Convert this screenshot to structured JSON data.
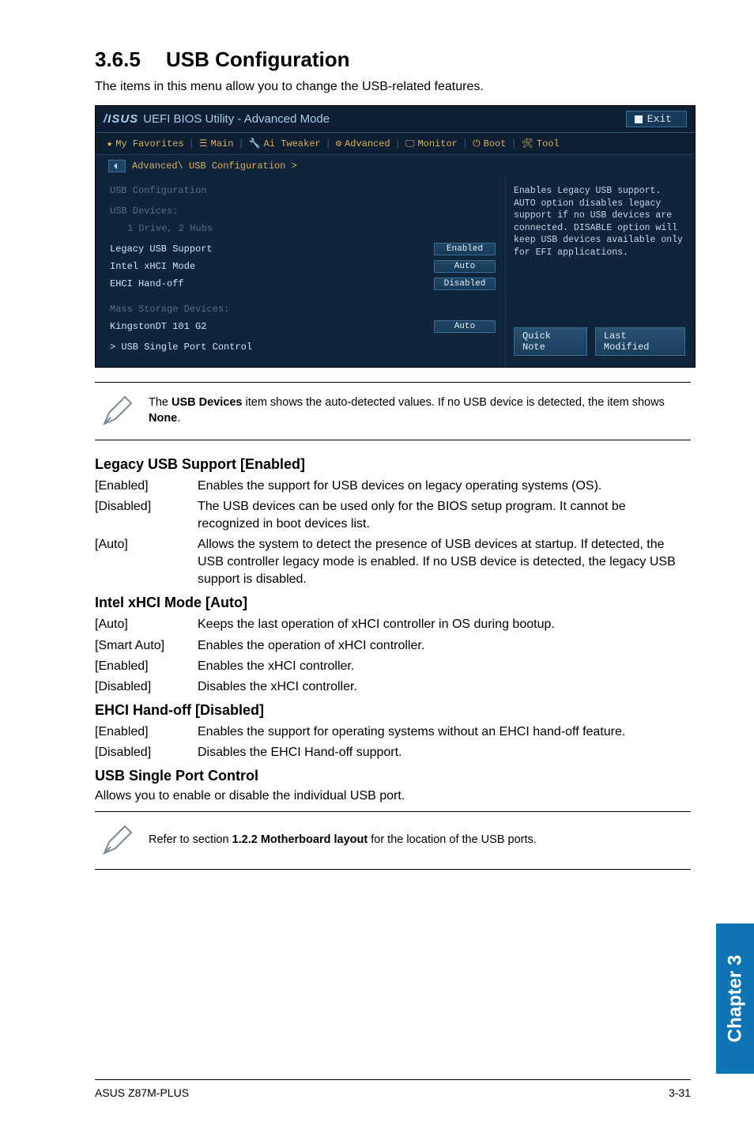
{
  "section": {
    "number": "3.6.5",
    "title": "USB Configuration"
  },
  "intro": "The items in this menu allow you to change the USB-related features.",
  "bios": {
    "brand_logo": "/ISUS",
    "title": "UEFI BIOS Utility - Advanced Mode",
    "exit_label": "Exit",
    "tabs": {
      "favorites": "My Favorites",
      "main": "Main",
      "ai_tweaker": "Ai Tweaker",
      "advanced": "Advanced",
      "monitor": "Monitor",
      "boot": "Boot",
      "tool": "Tool"
    },
    "breadcrumb": "Advanced\\ USB Configuration >",
    "left": {
      "heading": "USB Configuration",
      "devices_label": "USB Devices:",
      "devices_value": "1 Drive, 2 Hubs",
      "items": [
        {
          "label": "Legacy USB Support",
          "value": "Enabled"
        },
        {
          "label": "Intel xHCI Mode",
          "value": "Auto"
        },
        {
          "label": "EHCI Hand-off",
          "value": "Disabled"
        }
      ],
      "mass_heading": "Mass Storage Devices:",
      "mass_item": {
        "label": "KingstonDT 101 G2",
        "value": "Auto"
      },
      "single_port": "> USB Single Port Control"
    },
    "help": "Enables Legacy USB support. AUTO option disables legacy support if no USB devices are connected. DISABLE option will keep USB devices available only for EFI applications.",
    "quick_note": "Quick Note",
    "last_modified": "Last Modified"
  },
  "note1": {
    "prefix": "The ",
    "bold": "USB Devices",
    "mid": " item shows the auto-detected values. If no USB device is detected, the item shows ",
    "bold2": "None",
    "suffix": "."
  },
  "legacy": {
    "heading": "Legacy USB Support [Enabled]",
    "rows": [
      {
        "key": "[Enabled]",
        "val": "Enables the support for USB devices on legacy operating systems (OS)."
      },
      {
        "key": "[Disabled]",
        "val": "The USB devices can be used only for the BIOS setup program. It cannot be recognized in boot devices list."
      },
      {
        "key": "[Auto]",
        "val": "Allows the system to detect the presence of USB devices at startup. If detected, the USB controller legacy mode is enabled. If no USB device is detected, the legacy USB support is disabled."
      }
    ]
  },
  "xhci": {
    "heading": "Intel xHCI Mode [Auto]",
    "rows": [
      {
        "key": "[Auto]",
        "val": "Keeps the last operation of xHCI controller in OS during bootup."
      },
      {
        "key": "[Smart Auto]",
        "val": "Enables the operation of xHCI controller."
      },
      {
        "key": "[Enabled]",
        "val": "Enables the xHCI controller."
      },
      {
        "key": "[Disabled]",
        "val": "Disables the xHCI controller."
      }
    ]
  },
  "ehci": {
    "heading": "EHCI Hand-off [Disabled]",
    "rows": [
      {
        "key": "[Enabled]",
        "val": "Enables the support for operating systems without an EHCI hand-off feature."
      },
      {
        "key": "[Disabled]",
        "val": "Disables the EHCI Hand-off support."
      }
    ]
  },
  "singleport": {
    "heading": "USB Single Port Control",
    "desc": "Allows you to enable or disable the individual USB port."
  },
  "note2": {
    "prefix": "Refer to section ",
    "bold": "1.2.2 Motherboard layout",
    "suffix": " for the location of the USB ports."
  },
  "chapter_tab": "Chapter 3",
  "footer": {
    "left": "ASUS Z87M-PLUS",
    "right": "3-31"
  }
}
